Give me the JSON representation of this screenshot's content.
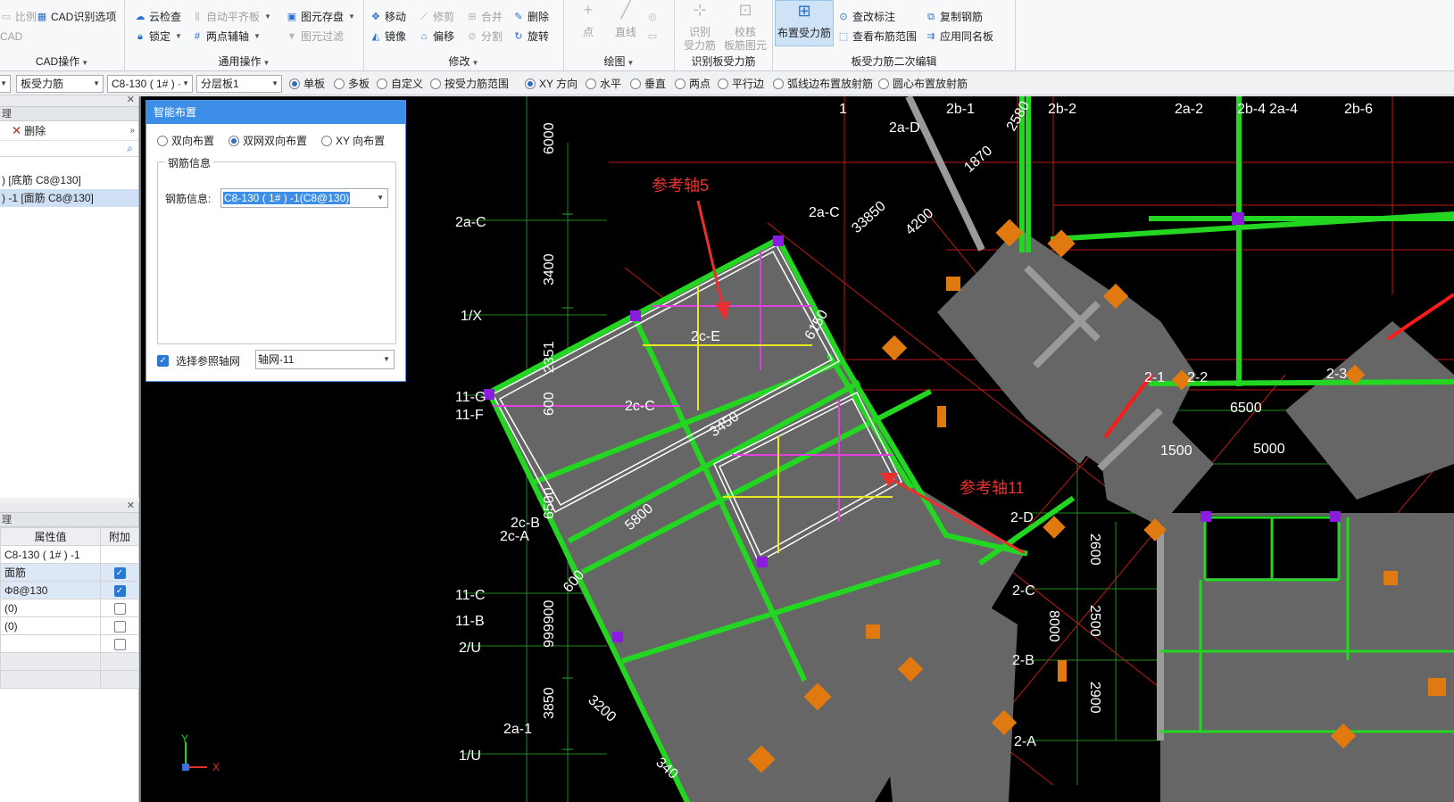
{
  "ribbon": {
    "groups": [
      {
        "label": "CAD操作",
        "items": [
          "比例",
          "CAD识别选项",
          "CAD"
        ]
      },
      {
        "label": "通用操作",
        "items": [
          "云检查",
          "锁定",
          "自动平齐板",
          "两点辅轴",
          "图元存盘",
          "图元过滤"
        ]
      },
      {
        "label": "修改",
        "items": [
          "移动",
          "修剪",
          "合并",
          "删除",
          "镜像",
          "偏移",
          "分割",
          "旋转"
        ]
      },
      {
        "label": "绘图",
        "items": [
          "点",
          "直线"
        ]
      },
      {
        "label": "识别板受力筋",
        "items": [
          "识别受力筋",
          "校核板筋图元"
        ]
      },
      {
        "label": "板受力筋二次编辑",
        "items": [
          "布置受力筋",
          "查改标注",
          "查看布筋范围",
          "复制钢筋",
          "应用同名板"
        ]
      }
    ],
    "big_buttons": {
      "identify": [
        "识别",
        "受力筋"
      ],
      "check": [
        "校核",
        "板筋图元"
      ],
      "place": "布置受力筋"
    }
  },
  "toolbar2": {
    "combo1": "板受力筋",
    "combo2": "C8-130 ( 1# ) ·",
    "combo3": "分层板1",
    "radios": [
      "单板",
      "多板",
      "自定义",
      "按受力筋范围",
      "XY 方向",
      "水平",
      "垂直",
      "两点",
      "平行边",
      "弧线边布置放射筋",
      "圆心布置放射筋"
    ]
  },
  "left_top": {
    "header": "理",
    "delete": "删除",
    "tree": [
      ") [底筋 C8@130]",
      ") -1 [面筋 C8@130]"
    ]
  },
  "left_bottom": {
    "header": "理",
    "col_value": "属性值",
    "col_extra": "附加",
    "rows": [
      {
        "value": "C8-130 ( 1# ) -1",
        "checked": null
      },
      {
        "value": "面筋",
        "checked": true
      },
      {
        "value": "Φ8@130",
        "checked": true
      },
      {
        "value": "(0)",
        "checked": false
      },
      {
        "value": "(0)",
        "checked": false
      },
      {
        "value": "",
        "checked": false
      }
    ]
  },
  "dialog": {
    "title": "智能布置",
    "options": [
      "双向布置",
      "双网双向布置",
      "XY 向布置"
    ],
    "selected_option": "双网双向布置",
    "group_label": "钢筋信息",
    "field_label": "钢筋信息:",
    "field_value": "C8-130 ( 1# ) -1(C8@130)",
    "axis_checkbox": "选择参照轴网",
    "axis_value": "轴网-11"
  },
  "canvas": {
    "annotations": [
      "参考轴5",
      "参考轴11"
    ],
    "axis_labels_left": [
      "2a-C",
      "1/X",
      "11-G",
      "11-F",
      "2c-B",
      "2c-A",
      "11-C",
      "11-B",
      "2/U",
      "2a-1",
      "1/U"
    ],
    "axis_labels_top": [
      "1",
      "2b-1",
      "2b-2",
      "2a-2",
      "2b-4",
      "2a-4",
      "2b-6",
      "2a-D"
    ],
    "axis_labels_mid": [
      "2a-C",
      "2c-E",
      "2c-C",
      "2-1",
      "2-2",
      "2-3",
      "2-D",
      "2-C",
      "2-B",
      "2-A"
    ],
    "dimensions_vertical": [
      "6000",
      "3400",
      "2351",
      "600",
      "6500",
      "999900",
      "3850"
    ],
    "dimensions_other": [
      "2580",
      "1870",
      "33850",
      "4200",
      "6150",
      "3450",
      "5800",
      "600",
      "3200",
      "340",
      "6500",
      "1500",
      "5000",
      "2600",
      "8000",
      "2500",
      "2900"
    ],
    "ucs": {
      "y": "Y",
      "x": "X"
    }
  }
}
